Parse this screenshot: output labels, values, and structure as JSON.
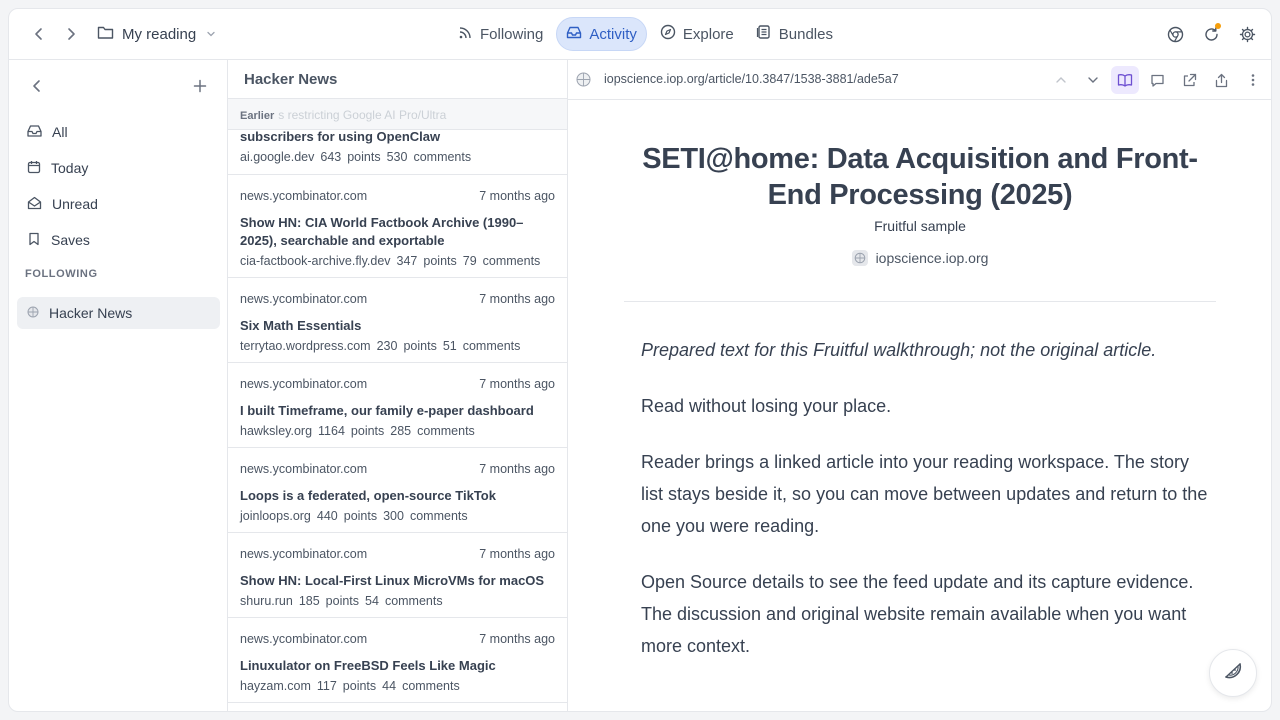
{
  "topbar": {
    "workspace_label": "My reading",
    "tabs": [
      {
        "label": "Following",
        "icon": "rss-icon"
      },
      {
        "label": "Activity",
        "icon": "inbox-icon"
      },
      {
        "label": "Explore",
        "icon": "compass-icon"
      },
      {
        "label": "Bundles",
        "icon": "bundle-icon"
      }
    ],
    "active_tab": "Activity",
    "notification_color": "#f59e0b"
  },
  "sidebar": {
    "items": [
      {
        "label": "All",
        "icon": "inbox-icon"
      },
      {
        "label": "Today",
        "icon": "calendar-icon"
      },
      {
        "label": "Unread",
        "icon": "envelope-open-icon"
      },
      {
        "label": "Saves",
        "icon": "bookmark-icon"
      }
    ],
    "section_label": "FOLLOWING",
    "feeds": [
      {
        "label": "Hacker News",
        "icon": "globe-icon",
        "active": true
      }
    ]
  },
  "list": {
    "title": "Hacker News",
    "group_label": "Earlier",
    "group_ghost": "s restricting Google AI Pro/Ultra",
    "first_partial": {
      "title": "subscribers for using OpenClaw",
      "domain": "ai.google.dev",
      "points": "643",
      "comments": "530"
    },
    "points_label": "points",
    "comments_label": "comments",
    "stories": [
      {
        "source": "news.ycombinator.com",
        "time": "7 months ago",
        "title": "Show HN: CIA World Factbook Archive (1990–2025), searchable and exportable",
        "domain": "cia-factbook-archive.fly.dev",
        "points": "347",
        "comments": "79"
      },
      {
        "source": "news.ycombinator.com",
        "time": "7 months ago",
        "title": "Six Math Essentials",
        "domain": "terrytao.wordpress.com",
        "points": "230",
        "comments": "51"
      },
      {
        "source": "news.ycombinator.com",
        "time": "7 months ago",
        "title": "I built Timeframe, our family e-paper dashboard",
        "domain": "hawksley.org",
        "points": "1164",
        "comments": "285"
      },
      {
        "source": "news.ycombinator.com",
        "time": "7 months ago",
        "title": "Loops is a federated, open-source TikTok",
        "domain": "joinloops.org",
        "points": "440",
        "comments": "300"
      },
      {
        "source": "news.ycombinator.com",
        "time": "7 months ago",
        "title": "Show HN: Local-First Linux MicroVMs for macOS",
        "domain": "shuru.run",
        "points": "185",
        "comments": "54"
      },
      {
        "source": "news.ycombinator.com",
        "time": "7 months ago",
        "title": "Linuxulator on FreeBSD Feels Like Magic",
        "domain": "hayzam.com",
        "points": "117",
        "comments": "44"
      }
    ]
  },
  "reader": {
    "url": "iopscience.iop.org/article/10.3847/1538-3881/ade5a7",
    "title": "SETI@home: Data Acquisition and Front-End Processing (2025)",
    "subtitle": "Fruitful sample",
    "source": "iopscience.iop.org",
    "paragraphs": [
      "Prepared text for this Fruitful walkthrough; not the original article.",
      "Read without losing your place.",
      "Reader brings a linked article into your reading workspace. The story list stays beside it, so you can move between updates and return to the one you were reading.",
      "Open Source details to see the feed update and its capture evidence. The discussion and original website remain available when you want more context."
    ],
    "accent_color": "#6d4fd1"
  }
}
